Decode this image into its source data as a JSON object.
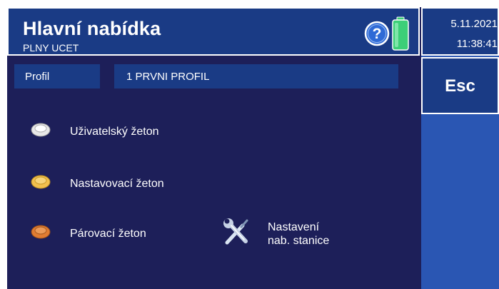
{
  "header": {
    "title": "Hlavní nabídka",
    "subtitle": "PLNY UCET",
    "icons": [
      "help-icon",
      "battery-icon"
    ]
  },
  "datetime": {
    "date": "5.11.2021",
    "time": "11:38:41"
  },
  "esc_button": {
    "label": "Esc"
  },
  "profile": {
    "label": "Profil",
    "value": "1 PRVNI PROFIL"
  },
  "menu": {
    "user_token": {
      "label": "Uživatelský žeton",
      "icon": "white-token-icon",
      "color": "#e8e8e8"
    },
    "setup_token": {
      "label": "Nastavovací žeton",
      "icon": "yellow-token-icon",
      "color": "#f2c04e"
    },
    "pairing_token": {
      "label": "Párovací žeton",
      "icon": "orange-token-icon",
      "color": "#e07c32"
    },
    "station_settings": {
      "line1": "Nastavení",
      "line2": "nab. stanice",
      "icon": "tools-icon"
    }
  },
  "colors": {
    "background": "#1d1f59",
    "header": "#1a3b85",
    "right_panel": "#2a56b3",
    "battery": "#3ccf78"
  }
}
